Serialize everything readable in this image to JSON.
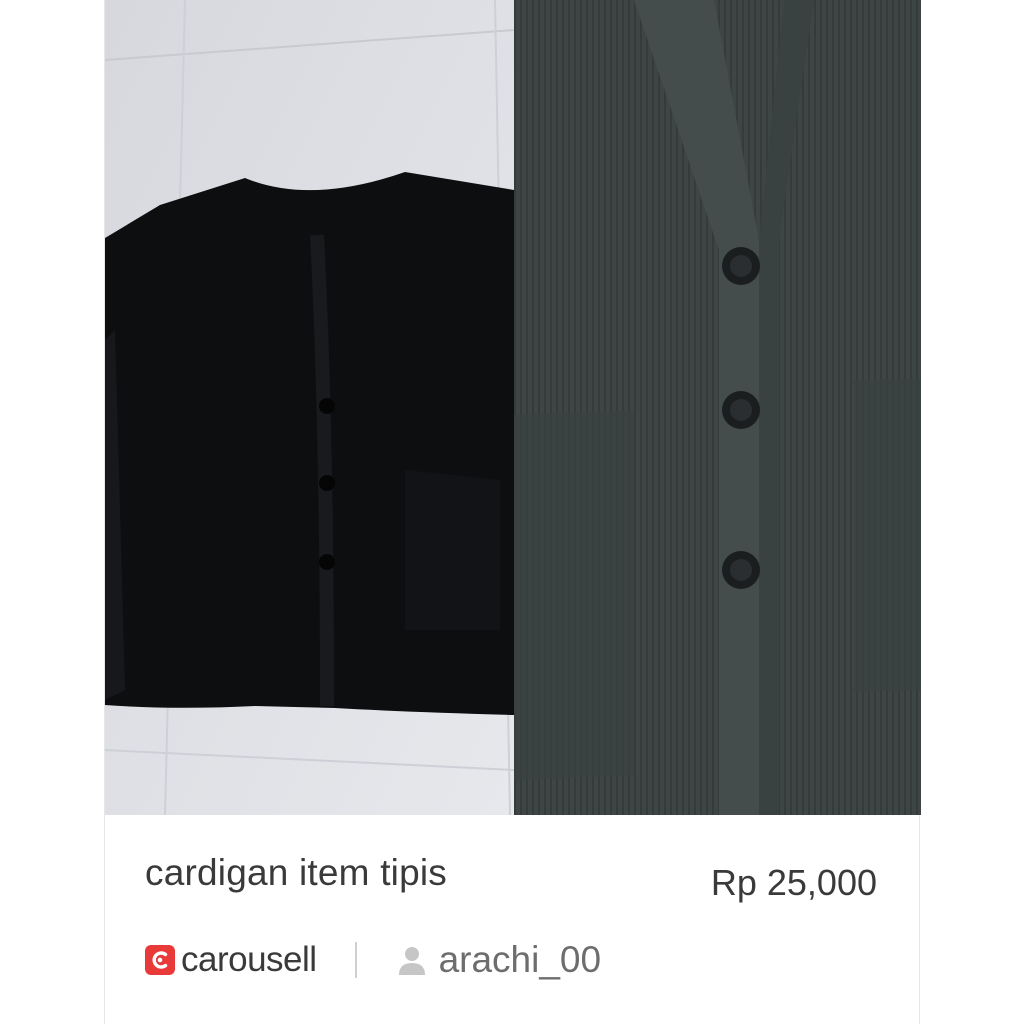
{
  "listing": {
    "title": "cardigan item tipis",
    "price": "Rp 25,000"
  },
  "brand": {
    "name": "carousell",
    "icon": "carousell-logo-icon",
    "color": "#e93a3a"
  },
  "seller": {
    "icon": "user-icon",
    "username": "arachi_00"
  },
  "colors": {
    "text": "#3a3a3a",
    "muted_text": "#6d6d6d",
    "divider": "#cfcfcf"
  }
}
